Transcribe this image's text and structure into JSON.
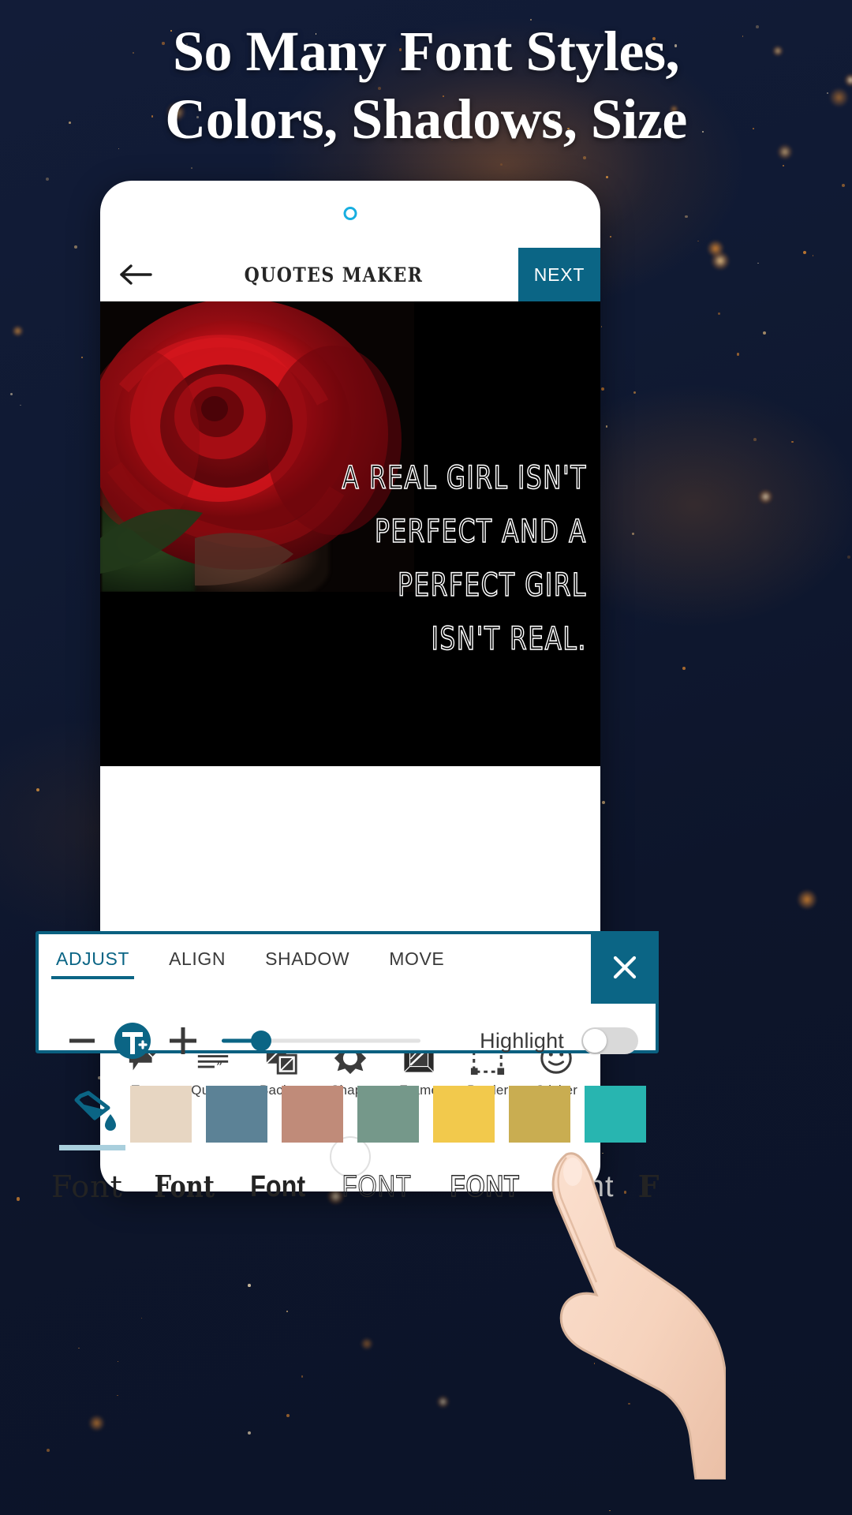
{
  "promo": {
    "headline_line1": "So Many Font Styles,",
    "headline_line2": "Colors, Shadows, Size"
  },
  "app": {
    "toolbar": {
      "back_icon": "arrow-left-icon",
      "title": "QUOTES MAKER",
      "next_label": "NEXT"
    },
    "canvas": {
      "quote_text": "A REAL GIRL ISN'T PERFECT AND A PERFECT GIRL ISN'T REAL.",
      "background_color": "#000000",
      "photo": "red-rose-photo"
    },
    "bottom_rail": [
      {
        "label": "Text",
        "icon": "text-bubble-pencil-icon"
      },
      {
        "label": "Quot…",
        "icon": "quote-lines-icon"
      },
      {
        "label": "Back…",
        "icon": "background-layers-icon"
      },
      {
        "label": "Shape",
        "icon": "starburst-shape-icon"
      },
      {
        "label": "Frame",
        "icon": "picture-frame-icon"
      },
      {
        "label": "Border",
        "icon": "dashed-border-icon"
      },
      {
        "label": "Sticker",
        "icon": "sticker-smiley-icon"
      }
    ]
  },
  "edit_panel": {
    "tabs": [
      {
        "label": "ADJUST",
        "active": true
      },
      {
        "label": "ALIGN",
        "active": false
      },
      {
        "label": "SHADOW",
        "active": false
      },
      {
        "label": "MOVE",
        "active": false
      }
    ],
    "close_icon": "close-icon",
    "controls": {
      "decrease_icon": "minus-icon",
      "textsize_icon": "text-size-icon",
      "increase_icon": "plus-icon",
      "slider_value_percent": 20,
      "highlight_label": "Highlight",
      "highlight_enabled": false
    },
    "color_tool_icon": "paint-bucket-icon",
    "swatches": [
      "#e7d6c2",
      "#5c8296",
      "#c08b79",
      "#75988a",
      "#f2c94c",
      "#c9ad51",
      "#28b5b0"
    ],
    "fonts": [
      {
        "preview": "Font",
        "style": "slab-serif"
      },
      {
        "preview": "Font",
        "style": "condensed-serif"
      },
      {
        "preview": "Font",
        "style": "bold-sans"
      },
      {
        "preview": "FONT",
        "style": "outline-caps"
      },
      {
        "preview": "FONT",
        "style": "outline-bold-caps"
      },
      {
        "preview": "Font",
        "style": "light-gray"
      },
      {
        "preview": "F",
        "style": "serif-bold-cut"
      }
    ]
  },
  "theme": {
    "accent": "#0b6585",
    "panel_border": "#0a6080",
    "background_dark": "#101a33",
    "camera_dot": "#17aee0"
  },
  "cursor": {
    "icon": "pointing-hand-cursor"
  }
}
